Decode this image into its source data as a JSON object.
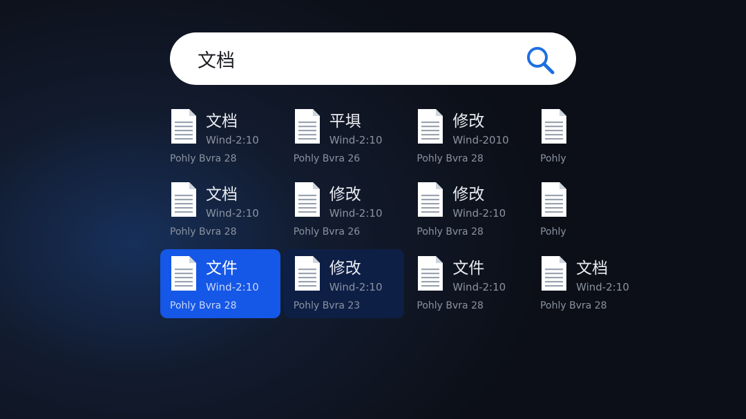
{
  "search": {
    "query": "文档",
    "icon": "search-icon",
    "icon_color": "#1e6fe0"
  },
  "colors": {
    "selected_item": "#1557e6",
    "hovered_item": "#0e1f46"
  },
  "results": [
    {
      "name": "文档",
      "meta": "Wind-2:10",
      "owner": "Pohly Bvra 28",
      "state": "normal"
    },
    {
      "name": "平埧",
      "meta": "Wind-2:10",
      "owner": "Pohly Bvra 26",
      "state": "normal"
    },
    {
      "name": "修改",
      "meta": "Wind-2010",
      "owner": "Pohly Bvra 28",
      "state": "normal"
    },
    {
      "name": "",
      "meta": "",
      "owner": "Pohly",
      "state": "normal"
    },
    {
      "name": "文档",
      "meta": "Wind-2:10",
      "owner": "Pohly Bvra 28",
      "state": "normal"
    },
    {
      "name": "修改",
      "meta": "Wind-2:10",
      "owner": "Pohly Bvra 26",
      "state": "normal"
    },
    {
      "name": "修改",
      "meta": "Wind-2:10",
      "owner": "Pohly Bvra 28",
      "state": "normal"
    },
    {
      "name": "",
      "meta": "",
      "owner": "Pohly",
      "state": "normal"
    },
    {
      "name": "文件",
      "meta": "Wind-2:10",
      "owner": "Pohly Bvra 28",
      "state": "selected"
    },
    {
      "name": "修改",
      "meta": "Wind-2:10",
      "owner": "Pohly Bvra 23",
      "state": "hover"
    },
    {
      "name": "文件",
      "meta": "Wind-2:10",
      "owner": "Pohly Bvra 28",
      "state": "normal"
    },
    {
      "name": "文档",
      "meta": "Wind-2:10",
      "owner": "Pohly Bvra 28",
      "state": "normal"
    }
  ]
}
